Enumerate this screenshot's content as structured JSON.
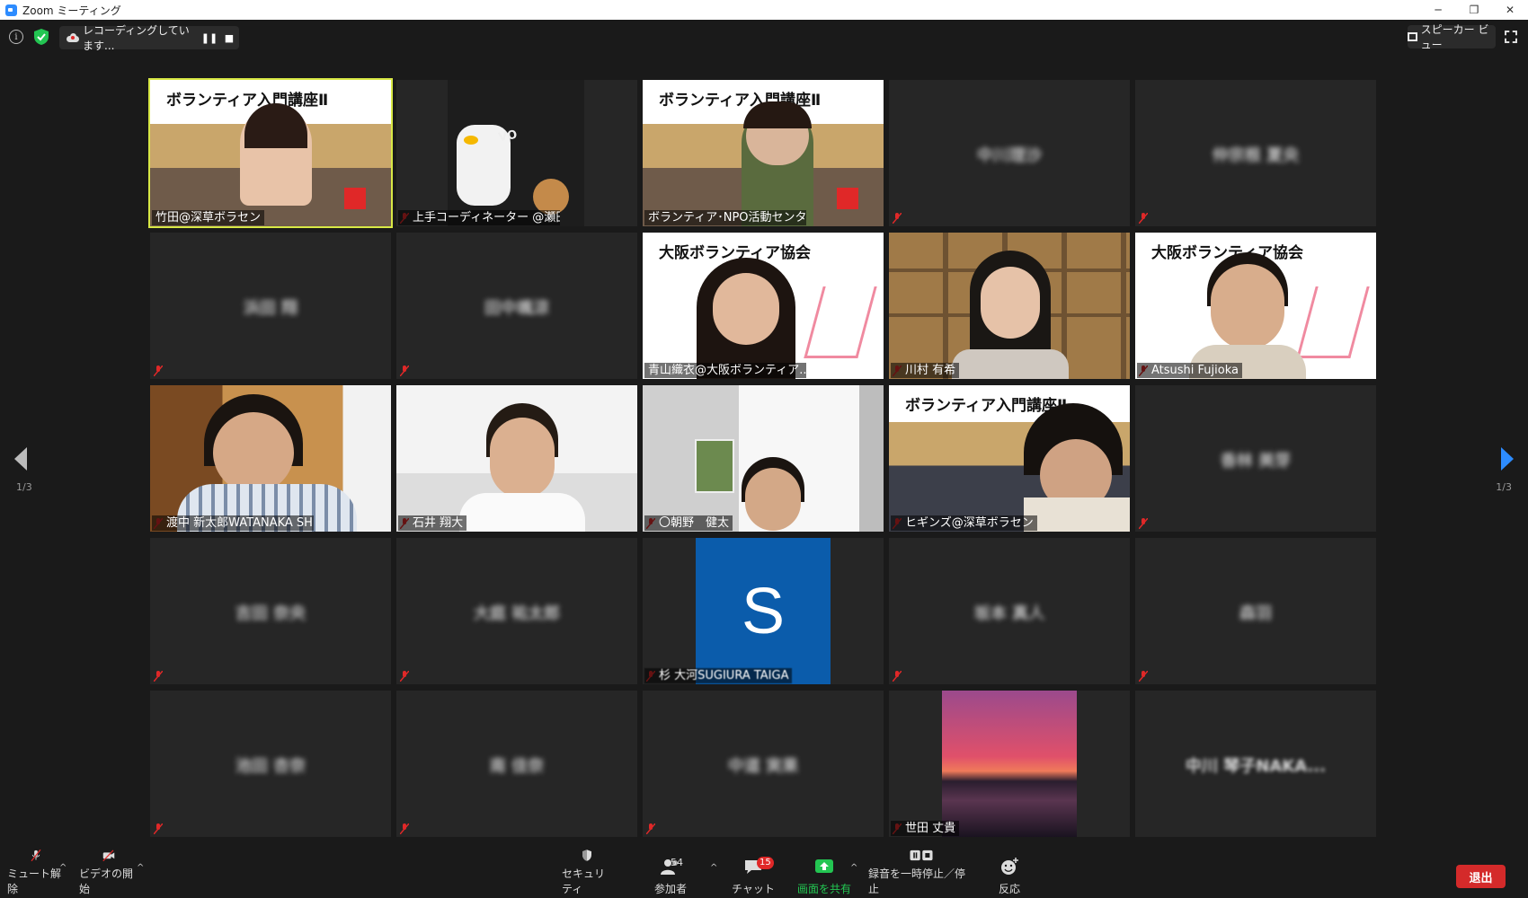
{
  "window": {
    "title": "Zoom ミーティング"
  },
  "topbar": {
    "recording_text": "レコーディングしています...",
    "pause_label": "❚❚",
    "stop_label": "■",
    "speaker_view_label": "スピーカー ビュー"
  },
  "gallery": {
    "page_indicator_left": "1/3",
    "page_indicator_right": "1/3",
    "banner_text": "ボランティア入門講座Ⅱ",
    "osaka_banner_text": "大阪ボランティア協会",
    "tiles": [
      {
        "label": "竹田@深草ボラセン"
      },
      {
        "label": "上手コーディネーター @瀬田"
      },
      {
        "label": "ボランティア･NPO活動センター ..."
      },
      {
        "label": "",
        "display_name": "中川理沙"
      },
      {
        "label": "",
        "display_name": "仲宗根 夏央"
      },
      {
        "label": "",
        "display_name": "浜田 翔"
      },
      {
        "label": "",
        "display_name": "田中颯涼"
      },
      {
        "label": "青山織衣@大阪ボランティア..."
      },
      {
        "label": "川村 有希"
      },
      {
        "label": "Atsushi Fujioka"
      },
      {
        "label": "渡中 新太郎WATANAKA SHI..."
      },
      {
        "label": "石井 翔大"
      },
      {
        "label": "〇朝野　健太"
      },
      {
        "label": "ヒギンズ@深草ボラセン"
      },
      {
        "label": "",
        "display_name": "香林 美芽"
      },
      {
        "label": "",
        "display_name": "吉田 奈央"
      },
      {
        "label": "",
        "display_name": "大庭 祐太郎"
      },
      {
        "label": "杉 大河SUGIURA TAIGA",
        "avatar_letter": "S"
      },
      {
        "label": "",
        "display_name": "坂本 真人"
      },
      {
        "label": "",
        "display_name": "森羽"
      },
      {
        "label": "",
        "display_name": "池田 杏奈"
      },
      {
        "label": "",
        "display_name": "南 佳奈"
      },
      {
        "label": "",
        "display_name": "中道 実果"
      },
      {
        "label": "世田 丈貴"
      },
      {
        "label": "",
        "display_name": "中川 琴子NAKA..."
      }
    ]
  },
  "toolbar": {
    "unmute_label": "ミュート解除",
    "video_label": "ビデオの開始",
    "security_label": "セキュリティ",
    "participants_label": "参加者",
    "participants_count": "54",
    "chat_label": "チャット",
    "chat_badge": "15",
    "share_label": "画面を共有",
    "pause_recording_label": "録音を一時停止／停止",
    "reactions_label": "反応",
    "leave_label": "退出"
  },
  "colors": {
    "accent": "#2d8cff",
    "share_green": "#23c552",
    "leave_red": "#d42a2a",
    "active_border": "#d8e845",
    "avatar_blue": "#0b5cab"
  }
}
